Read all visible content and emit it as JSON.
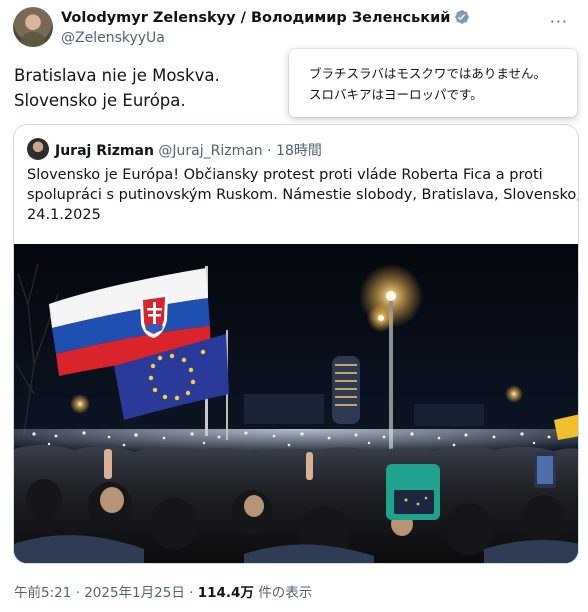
{
  "author": {
    "display_name": "Volodymyr Zelenskyy / Володимир Зеленський",
    "handle": "@ZelenskyyUa"
  },
  "tweet": {
    "lines": [
      "Bratislava nie je Moskva.",
      "Slovensko je Európa."
    ]
  },
  "translation": {
    "lines": [
      "ブラチスラバはモスクワではありません。",
      "スロバキアはヨーロッパです。"
    ]
  },
  "quote": {
    "name": "Juraj Rizman",
    "handle": "@Juraj_Rizman",
    "separator": " · ",
    "time": "18時間",
    "lines": [
      "Slovensko je Európa! Občiansky protest proti vláde Roberta Fica a proti",
      "spolupráci s putinovským Ruskom. Námestie slobody, Bratislava, Slovensko,",
      "24.1.2025"
    ]
  },
  "footer": {
    "time": "午前5:21",
    "separator": " · ",
    "date": "2025年1月25日",
    "views": "114.4万",
    "views_label": " 件の表示"
  },
  "colors": {
    "verified": "#829aab",
    "text": "#0f1419",
    "secondary": "#536471",
    "border": "#cfd9de"
  }
}
